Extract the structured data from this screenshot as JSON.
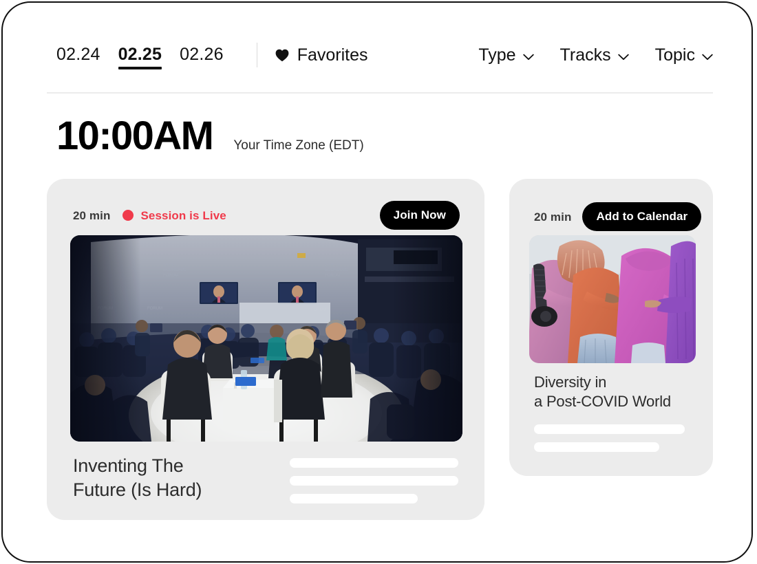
{
  "header": {
    "dates": [
      {
        "label": "02.24",
        "active": false
      },
      {
        "label": "02.25",
        "active": true
      },
      {
        "label": "02.26",
        "active": false
      }
    ],
    "favorites_label": "Favorites",
    "favorites_icon": "heart-icon",
    "filters": [
      {
        "label": "Type",
        "icon": "chevron-down-icon"
      },
      {
        "label": "Tracks",
        "icon": "chevron-down-icon"
      },
      {
        "label": "Topic",
        "icon": "chevron-down-icon"
      }
    ]
  },
  "schedule": {
    "time": "10:00AM",
    "timezone": "Your Time Zone (EDT)"
  },
  "sessions": [
    {
      "duration": "20 min",
      "status_label": "Session is Live",
      "status_color": "#f03a4b",
      "action_label": "Join Now",
      "title": "Inventing The\nFuture (Is Hard)",
      "image_alt": "panel-discussion-on-stage"
    },
    {
      "duration": "20 min",
      "action_label": "Add to Calendar",
      "title": "Diversity in\na Post-COVID World",
      "image_alt": "people-embracing-outdoors"
    }
  ],
  "theme": {
    "card_background": "#ececec",
    "accent_black": "#000000",
    "live_red": "#f03a4b",
    "divider": "#ececec"
  }
}
